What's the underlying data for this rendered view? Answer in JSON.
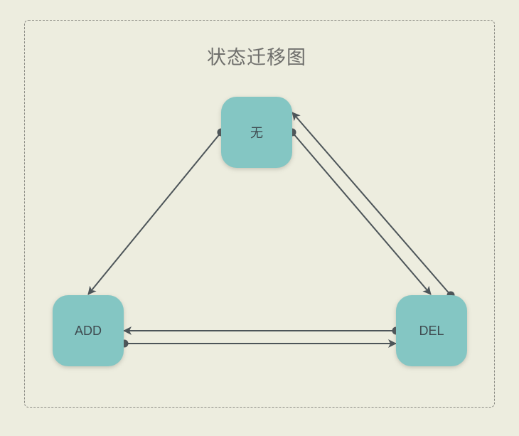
{
  "diagram": {
    "title": "状态迁移图",
    "nodes": {
      "none": "无",
      "add": "ADD",
      "del": "DEL"
    },
    "edges": [
      {
        "from": "none",
        "to": "add"
      },
      {
        "from": "none",
        "to": "del"
      },
      {
        "from": "del",
        "to": "none"
      },
      {
        "from": "del",
        "to": "add"
      },
      {
        "from": "add",
        "to": "del"
      }
    ],
    "colors": {
      "background": "#ededdf",
      "node_fill": "#84c6c3",
      "edge": "#4d5559",
      "title": "#6f6f6c",
      "frame": "#8b8b84"
    }
  }
}
